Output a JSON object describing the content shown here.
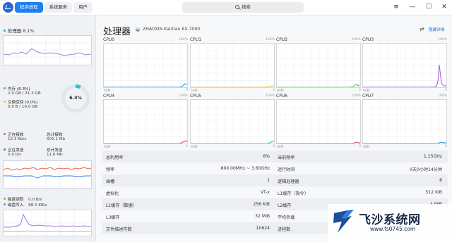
{
  "titlebar": {
    "tabs": [
      {
        "label": "程序进程",
        "active": true
      },
      {
        "label": "系统服务",
        "active": false
      },
      {
        "label": "用户",
        "active": false
      }
    ],
    "search_label": "搜索",
    "menu_icon": "≡",
    "minimize_icon": "—",
    "maximize_icon": "☐",
    "close_icon": "✕"
  },
  "sidebar": {
    "cpu": {
      "label": "处理器",
      "value": "8.1%",
      "color": "#1ba4e7"
    },
    "memory": {
      "label": "内存 (6.3%)",
      "detail": "2.0 GB / 31.3 GB",
      "color": "#35c3c1"
    },
    "swap": {
      "label": "交换空间 (0.0%)",
      "detail": "0.0 B / 16.0 GB",
      "color": "#f0c93c"
    },
    "ring_label": "6.3%",
    "ring_percent": 6.3,
    "net": {
      "recv_label": "正在接收",
      "recv_value": "12.3 Kb/s",
      "total_recv_label": "总计接收",
      "total_recv_value": "501.1 Mb",
      "send_label": "正在发送",
      "send_value": "0.0 b/s",
      "total_send_label": "总计发送",
      "total_send_value": "11.6 Mb",
      "recv_color": "#e8663d",
      "send_color": "#3d7be8"
    },
    "disk": {
      "read_label": "磁盘读取",
      "read_value": "0.0 B/s",
      "write_label": "磁盘写入",
      "write_value": "88.0 KB/s",
      "read_color": "#7cc444",
      "write_color": "#a078e0"
    }
  },
  "main": {
    "title": "处理器",
    "cpu_model": "ZHAOXIN KaiXian KX-7000",
    "hide_detail": "隐藏详情",
    "axis_100": "100%",
    "axis_60s": "60秒",
    "axis_0": "0",
    "cpus": [
      {
        "name": "CPU0",
        "color": "#1b8fe0"
      },
      {
        "name": "CPU1",
        "color": "#e8c23d"
      },
      {
        "name": "CPU2",
        "color": "#4fc24f"
      },
      {
        "name": "CPU3",
        "color": "#a05ad8"
      },
      {
        "name": "CPU4",
        "color": "#e0455a"
      },
      {
        "name": "CPU5",
        "color": "#2ab7c2"
      },
      {
        "name": "CPU6",
        "color": "#e0455a"
      },
      {
        "name": "CPU7",
        "color": "#1b8fe0"
      }
    ],
    "stats_left": [
      {
        "label": "总利用率",
        "value": "8%"
      },
      {
        "label": "频率",
        "value": "800.00MHz ~ 3.60GHz"
      },
      {
        "label": "插槽",
        "value": "1"
      },
      {
        "label": "虚拟化",
        "value": "VT-x"
      },
      {
        "label": "L1缓存（数据）",
        "value": "256 KiB"
      },
      {
        "label": "L3缓存",
        "value": "32 MiB"
      },
      {
        "label": "文件描述符数",
        "value": "10624"
      }
    ],
    "stats_right": [
      {
        "label": "当前频率",
        "value": "1.15GHz"
      },
      {
        "label": "运行时间",
        "value": "0天0小时14分钟"
      },
      {
        "label": "逻辑处理器",
        "value": "8"
      },
      {
        "label": "L1缓存（指令）",
        "value": "512 KiB"
      },
      {
        "label": "L2缓存",
        "value": "4 MiB"
      },
      {
        "label": "平均负载",
        "value": ""
      },
      {
        "label": "进程数",
        "value": ""
      }
    ]
  },
  "watermark": {
    "brand": "飞沙系统网",
    "url": "www.fs0745.com"
  }
}
